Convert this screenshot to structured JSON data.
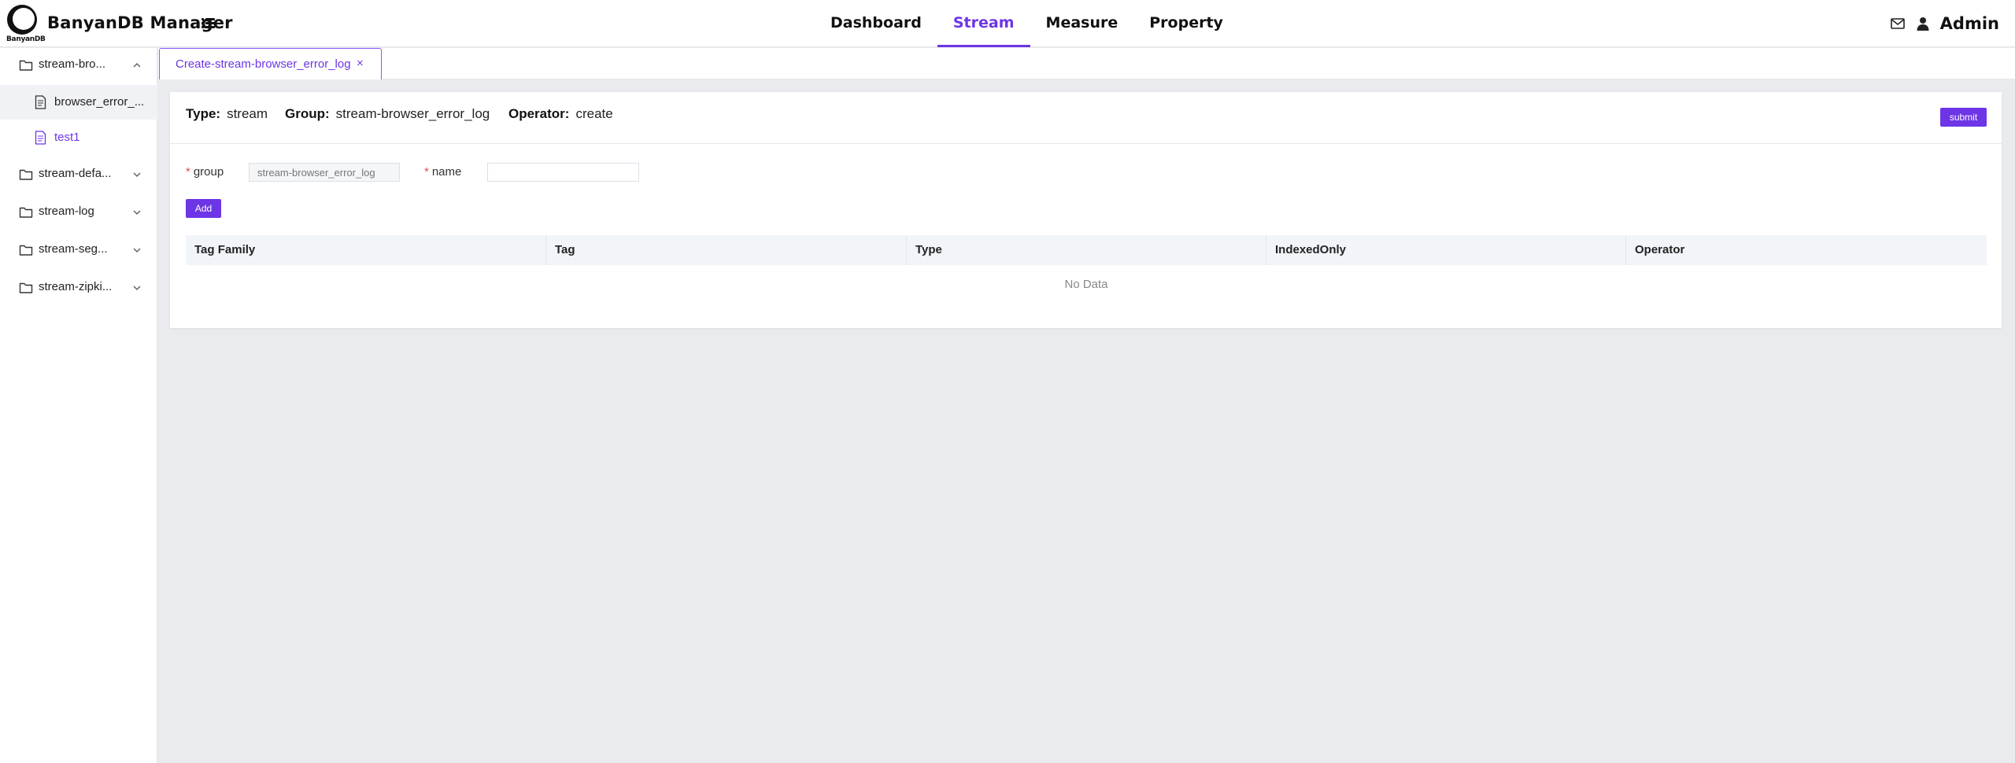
{
  "header": {
    "logo_text": "BanyanDB",
    "title": "BanyanDB Manager",
    "nav": [
      {
        "label": "Dashboard",
        "active": false
      },
      {
        "label": "Stream",
        "active": true
      },
      {
        "label": "Measure",
        "active": false
      },
      {
        "label": "Property",
        "active": false
      }
    ],
    "user": "Admin"
  },
  "sidebar": {
    "groups": [
      {
        "label": "stream-bro...",
        "expanded": true,
        "children": [
          {
            "label": "browser_error_...",
            "selected": false
          },
          {
            "label": "test1",
            "selected": true
          }
        ]
      },
      {
        "label": "stream-defa...",
        "expanded": false
      },
      {
        "label": "stream-log",
        "expanded": false
      },
      {
        "label": "stream-seg...",
        "expanded": false
      },
      {
        "label": "stream-zipki...",
        "expanded": false
      }
    ]
  },
  "tabs": [
    {
      "label": "Create-stream-browser_error_log",
      "close": "×",
      "active": true
    }
  ],
  "detail": {
    "type_label": "Type:",
    "type_value": "stream",
    "group_label": "Group:",
    "group_value": "stream-browser_error_log",
    "operator_label": "Operator:",
    "operator_value": "create",
    "submit_label": "submit"
  },
  "form": {
    "required_mark": "*",
    "group_label": "group",
    "group_placeholder": "stream-browser_error_log",
    "name_label": "name",
    "name_value": "",
    "add_label": "Add"
  },
  "table": {
    "columns": [
      "Tag Family",
      "Tag",
      "Type",
      "IndexedOnly",
      "Operator"
    ],
    "empty_text": "No Data"
  },
  "colors": {
    "accent": "#6d35e6",
    "background": "#e9ebef",
    "required": "#e34d4d"
  }
}
